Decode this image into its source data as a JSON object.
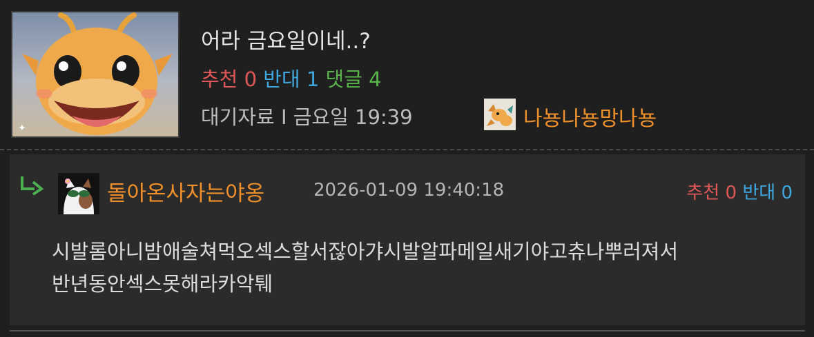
{
  "post": {
    "title": "어라 금요일이네..?",
    "stats": {
      "recommend_label": "추천",
      "recommend_count": "0",
      "oppose_label": "반대",
      "oppose_count": "1",
      "comment_label": "댓글",
      "comment_count": "4"
    },
    "meta": {
      "category": "대기자료",
      "separator": "I",
      "time": "금요일 19:39",
      "author": "나뇽나뇽망나뇽",
      "author_icon": "dragonite-icon"
    },
    "thumbnail": "dragonite-thumbnail"
  },
  "comment": {
    "reply_icon": "reply-arrow-icon",
    "author": "돌아온사자는야옹",
    "avatar": "cat-with-sunglasses-avatar",
    "date": "2026-01-09 19:40:18",
    "recommend_label": "추천",
    "recommend_count": "0",
    "oppose_label": "반대",
    "oppose_count": "0",
    "body_line1": "시발롬아니밤애술쳐먹오섹스할서잖아갸시발알파메일새기야고츄나뿌러져서",
    "body_line2": "반년동안섹스못해라카악퉤"
  },
  "colors": {
    "background": "#1f1f1f",
    "comment_background": "#2b2b2b",
    "recommend": "#e05757",
    "oppose": "#3fa7e0",
    "comments": "#59b34a",
    "author": "#f0902a"
  }
}
